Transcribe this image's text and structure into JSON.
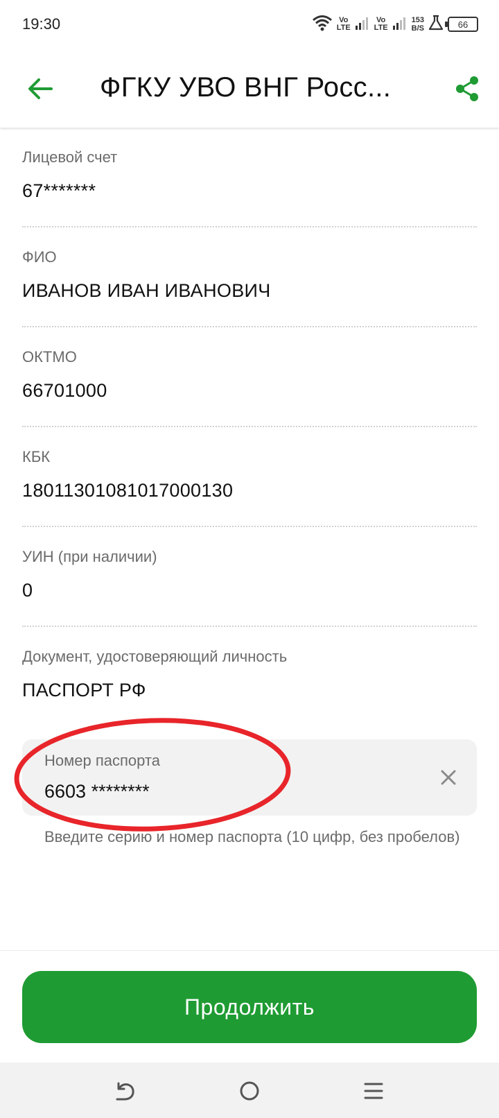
{
  "status_bar": {
    "time": "19:30",
    "sim1_label": "Vo\nLTE",
    "sim2_label": "Vo\nLTE",
    "speed_value": "153",
    "speed_unit": "B/S",
    "battery": "66"
  },
  "header": {
    "title": "ФГКУ УВО ВНГ Росс..."
  },
  "fields": [
    {
      "label": "Лицевой счет",
      "value": "67*******"
    },
    {
      "label": "ФИО",
      "value": "ИВАНОВ ИВАН ИВАНОВИЧ"
    },
    {
      "label": "ОКТМО",
      "value": "66701000"
    },
    {
      "label": "КБК",
      "value": "18011301081017000130"
    },
    {
      "label": "УИН (при наличии)",
      "value": "0"
    },
    {
      "label": "Документ, удостоверяющий личность",
      "value": "ПАСПОРТ РФ"
    }
  ],
  "passport_input": {
    "label": "Номер паспорта",
    "value": "6603 ********",
    "helper": "Введите серию и номер паспорта (10 цифр, без пробелов)"
  },
  "continue_button": {
    "label": "Продолжить"
  },
  "colors": {
    "accent": "#1f9b33",
    "highlight": "#e8252a"
  }
}
